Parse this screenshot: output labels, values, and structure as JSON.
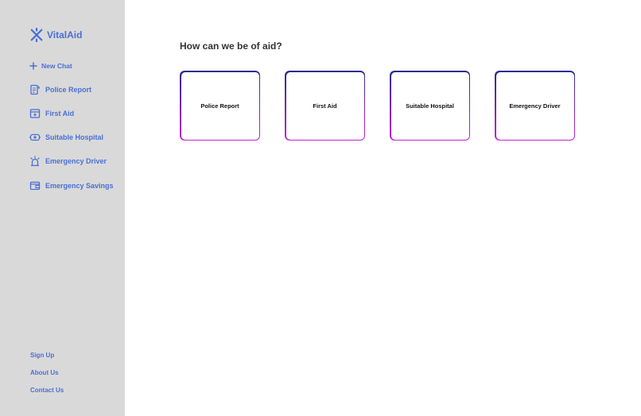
{
  "brand": {
    "name": "VitalAid",
    "color": "#4a6fd6"
  },
  "sidebar": {
    "new_chat": {
      "label": "New Chat",
      "icon": "plus-icon"
    },
    "items": [
      {
        "label": "Police Report",
        "icon": "clipboard-icon"
      },
      {
        "label": "First Aid",
        "icon": "first-aid-kit-icon"
      },
      {
        "label": "Suitable Hospital",
        "icon": "hospital-icon"
      },
      {
        "label": "Emergency Driver",
        "icon": "siren-icon"
      },
      {
        "label": "Emergency Savings",
        "icon": "wallet-icon"
      }
    ],
    "footer": [
      {
        "label": "Sign Up"
      },
      {
        "label": "About Us"
      },
      {
        "label": "Contact Us"
      }
    ]
  },
  "main": {
    "title": "How can we be of aid?",
    "cards": [
      {
        "label": "Police Report"
      },
      {
        "label": "First Aid"
      },
      {
        "label": "Suitable Hospital"
      },
      {
        "label": "Emergency Driver"
      }
    ]
  },
  "colors": {
    "sidebar_bg": "#d9d9d9",
    "accent": "#4a6fd6",
    "card_border_top": "#2b2b8c",
    "card_border_bottom": "#c026d3"
  }
}
